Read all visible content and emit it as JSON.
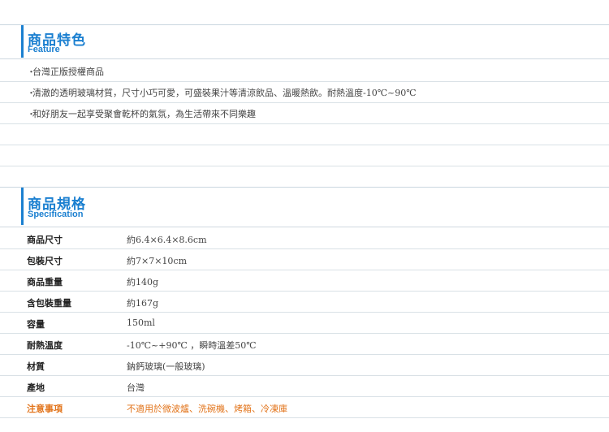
{
  "feature_section": {
    "title_zh": "商品特色",
    "title_en": "Feature",
    "items": [
      "台灣正版授權商品",
      "清澈的透明玻璃材質，尺寸小巧可愛，可盛裝果汁等清涼飲品、溫暖熱飲。耐熱溫度-10℃~90℃",
      "和好朋友一起享受聚會乾杯的氣氛，為生活帶來不同樂趣"
    ],
    "bullet": "・"
  },
  "spec_section": {
    "title_zh": "商品規格",
    "title_en": "Specification",
    "rows": [
      {
        "label": "商品尺寸",
        "value": "約6.4×6.4×8.6cm"
      },
      {
        "label": "包裝尺寸",
        "value": "約7×7×10cm"
      },
      {
        "label": "商品重量",
        "value": "約140g"
      },
      {
        "label": "含包裝重量",
        "value": "約167g"
      },
      {
        "label": "容量",
        "value": "150ml"
      },
      {
        "label": "耐熱溫度",
        "value": "-10℃~+90℃ ，瞬時溫差50℃"
      },
      {
        "label": "材質",
        "value": "鈉鈣玻璃(一般玻璃)"
      },
      {
        "label": "產地",
        "value": "台灣"
      },
      {
        "label": "注意事項",
        "value": "不適用於微波爐、洗碗機、烤箱、冷凍庫"
      }
    ]
  },
  "colors": {
    "accent": "#1a7fd0",
    "warning": "#e2741b"
  }
}
